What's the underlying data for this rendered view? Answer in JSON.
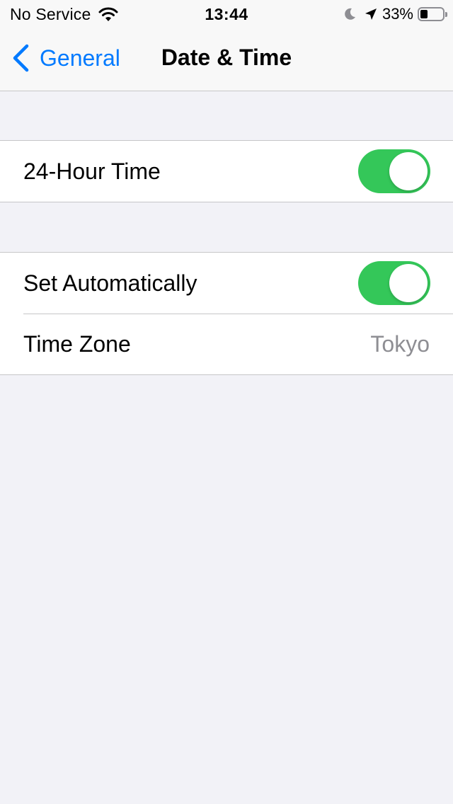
{
  "status_bar": {
    "carrier": "No Service",
    "time": "13:44",
    "battery_percent": "33%",
    "battery_level": 0.33,
    "icons": [
      "wifi-icon",
      "moon-icon",
      "location-arrow-icon",
      "battery-icon"
    ]
  },
  "nav": {
    "back_label": "General",
    "title": "Date & Time"
  },
  "settings": {
    "hour24": {
      "label": "24-Hour Time",
      "enabled": true
    },
    "set_automatically": {
      "label": "Set Automatically",
      "enabled": true
    },
    "time_zone": {
      "label": "Time Zone",
      "value": "Tokyo"
    }
  },
  "colors": {
    "accent": "#007aff",
    "toggle_on": "#34c759",
    "background": "#f2f2f7",
    "secondary_text": "#8e8e93"
  }
}
